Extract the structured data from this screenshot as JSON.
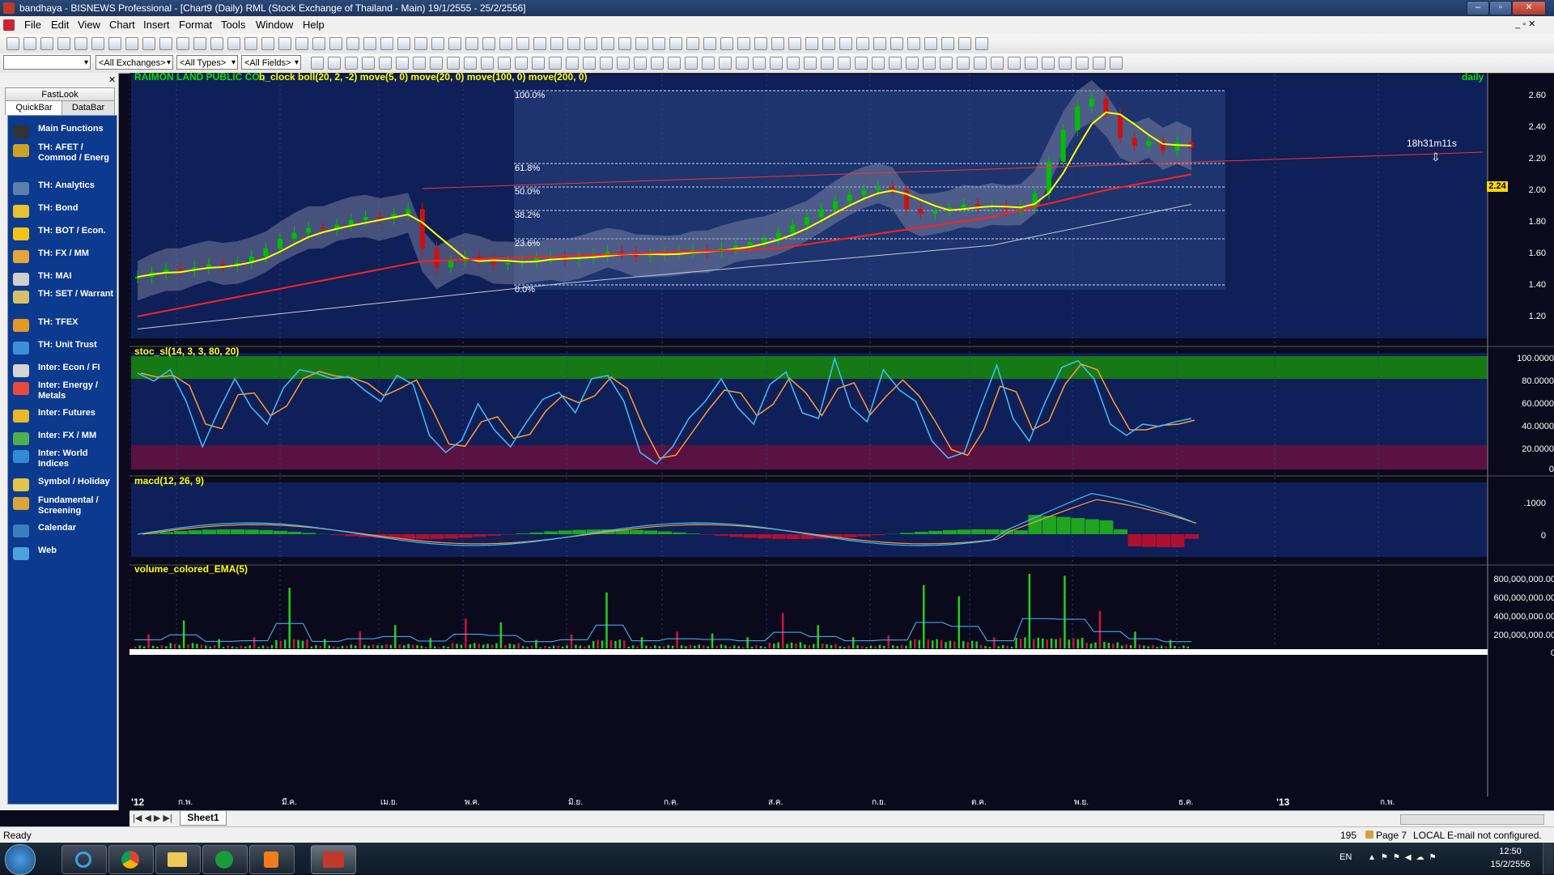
{
  "window": {
    "title": "bandhaya - BISNEWS Professional - [Chart9 (Daily)  RML (Stock Exchange of Thailand - Main) 19/1/2555 - 25/2/2556]"
  },
  "menu": [
    "File",
    "Edit",
    "View",
    "Chart",
    "Insert",
    "Format",
    "Tools",
    "Window",
    "Help"
  ],
  "toolbar": {
    "exchanges": "<All Exchanges>",
    "types": "<All Types>",
    "fields": "<All Fields>"
  },
  "sidebar": {
    "fastlook": "FastLook",
    "tabs": [
      "QuickBar",
      "DataBar"
    ],
    "items": [
      {
        "label": "Main Functions",
        "icon": "monitor-icon",
        "color": "#333333"
      },
      {
        "label": "TH: AFET / Commod / Energ",
        "icon": "commodity-icon",
        "color": "#c9a227"
      },
      {
        "label": "TH: Analytics",
        "icon": "binoculars-icon",
        "color": "#5b7fa8"
      },
      {
        "label": "TH: Bond",
        "icon": "bond-icon",
        "color": "#e8c233"
      },
      {
        "label": "TH: BOT / Econ.",
        "icon": "bank-icon",
        "color": "#f0c419"
      },
      {
        "label": "TH: FX / MM",
        "icon": "exchange-icon",
        "color": "#e7a53a"
      },
      {
        "label": "TH: MAI",
        "icon": "mai-icon",
        "color": "#cfcfcf"
      },
      {
        "label": "TH: SET / Warrant",
        "icon": "set-icon",
        "color": "#d8c06a"
      },
      {
        "label": "TH: TFEX",
        "icon": "tfex-icon",
        "color": "#e09a2a"
      },
      {
        "label": "TH: Unit Trust",
        "icon": "unit-trust-icon",
        "color": "#3e8fd6"
      },
      {
        "label": "Inter: Econ / FI",
        "icon": "pillars-icon",
        "color": "#d4d4d4"
      },
      {
        "label": "Inter: Energy / Metals",
        "icon": "energy-icon",
        "color": "#e84b3c"
      },
      {
        "label": "Inter: Futures",
        "icon": "futures-icon",
        "color": "#e6b82e"
      },
      {
        "label": "Inter: FX / MM",
        "icon": "fx-icon",
        "color": "#4caf50"
      },
      {
        "label": "Inter: World Indices",
        "icon": "globe-icon",
        "color": "#2e8bd6"
      },
      {
        "label": "Symbol / Holiday",
        "icon": "symbol-icon",
        "color": "#e3c34a"
      },
      {
        "label": "Fundamental / Screening",
        "icon": "screening-icon",
        "color": "#d9a53a"
      },
      {
        "label": "Calendar",
        "icon": "calendar-icon",
        "color": "#3b7ec2"
      },
      {
        "label": "Web",
        "icon": "web-icon",
        "color": "#4aa3df"
      }
    ]
  },
  "panels": {
    "price_header": "RAIMON LAND PUBLIC CO.,",
    "price_indicators": "b_clock boll(20, 2, -2) move(5, 0) move(20, 0) move(100, 0) move(200, 0)",
    "period": "daily",
    "countdown": "18h31m11s",
    "last_price": "2.24",
    "stoch_header": "stoc_sl(14, 3, 3, 80, 20)",
    "macd_header": "macd(12, 26, 9)",
    "volume_header": "volume_colored_EMA(5)"
  },
  "fib_levels": [
    "100.0%",
    "61.8%",
    "50.0%",
    "38.2%",
    "23.6%",
    "0.0%"
  ],
  "price_axis": [
    "2.60",
    "2.40",
    "2.20",
    "2.00",
    "1.80",
    "1.60",
    "1.40",
    "1.20"
  ],
  "stoch_axis": [
    "100.0000",
    "80.0000",
    "60.0000",
    "40.0000",
    "20.0000",
    "0"
  ],
  "macd_axis": [
    ".1000",
    "0"
  ],
  "volume_axis": [
    "800,000,000.00",
    "600,000,000.00",
    "400,000,000.00",
    "200,000,000.00",
    "0"
  ],
  "time_axis": [
    "'12",
    "ก.พ.",
    "มี.ค.",
    "เม.ย.",
    "พ.ค.",
    "มิ.ย.",
    "ก.ค.",
    "ส.ค.",
    "ก.ย.",
    "ต.ค.",
    "พ.ย.",
    "ธ.ค.",
    "'13",
    "ก.พ."
  ],
  "sheet_tab": "Sheet1",
  "status": {
    "left": "Ready",
    "count": "195",
    "page": "Page 7",
    "local": "LOCAL",
    "email": "E-mail not configured."
  },
  "taskbar": {
    "lang": "EN",
    "time": "12:50",
    "date": "15/2/2556"
  },
  "colors": {
    "bull": "#00c000",
    "bear": "#d01010",
    "ma_yellow": "#ffff00",
    "ma_red": "#ff2020",
    "ma_white": "#c8c8d8",
    "stoch_k": "#3fc0ff",
    "stoch_d": "#ff9a3a"
  },
  "chart_data": {
    "type": "line",
    "symbol": "RML",
    "ylim": [
      1.1,
      2.7
    ],
    "close": [
      1.42,
      1.45,
      1.47,
      1.46,
      1.48,
      1.5,
      1.49,
      1.51,
      1.55,
      1.6,
      1.66,
      1.7,
      1.73,
      1.72,
      1.75,
      1.78,
      1.8,
      1.79,
      1.82,
      1.85,
      1.6,
      1.48,
      1.52,
      1.55,
      1.53,
      1.5,
      1.51,
      1.52,
      1.54,
      1.55,
      1.53,
      1.54,
      1.56,
      1.58,
      1.57,
      1.55,
      1.56,
      1.57,
      1.58,
      1.59,
      1.58,
      1.6,
      1.62,
      1.64,
      1.66,
      1.7,
      1.75,
      1.8,
      1.85,
      1.9,
      1.94,
      1.97,
      1.99,
      1.97,
      1.85,
      1.82,
      1.84,
      1.86,
      1.88,
      1.86,
      1.87,
      1.85,
      1.86,
      1.95,
      2.15,
      2.35,
      2.5,
      2.55,
      2.45,
      2.3,
      2.25,
      2.28,
      2.22,
      2.27,
      2.24
    ],
    "stoch_k": [
      85,
      78,
      88,
      60,
      20,
      52,
      80,
      55,
      40,
      72,
      88,
      85,
      80,
      82,
      70,
      60,
      83,
      75,
      30,
      15,
      26,
      58,
      35,
      20,
      42,
      62,
      68,
      50,
      80,
      83,
      60,
      15,
      5,
      20,
      45,
      60,
      80,
      55,
      40,
      75,
      86,
      50,
      45,
      98,
      55,
      42,
      88,
      70,
      60,
      25,
      10,
      15,
      55,
      92,
      45,
      25,
      60,
      90,
      96,
      80,
      40,
      30,
      40,
      38,
      42,
      45
    ],
    "volume_peak_m": [
      150,
      300,
      100,
      120,
      650,
      100,
      180,
      250,
      110,
      320,
      280,
      90,
      150,
      600,
      120,
      180,
      160,
      120,
      380,
      250,
      120,
      140,
      680,
      560,
      120,
      800,
      780,
      400,
      180,
      90
    ]
  }
}
